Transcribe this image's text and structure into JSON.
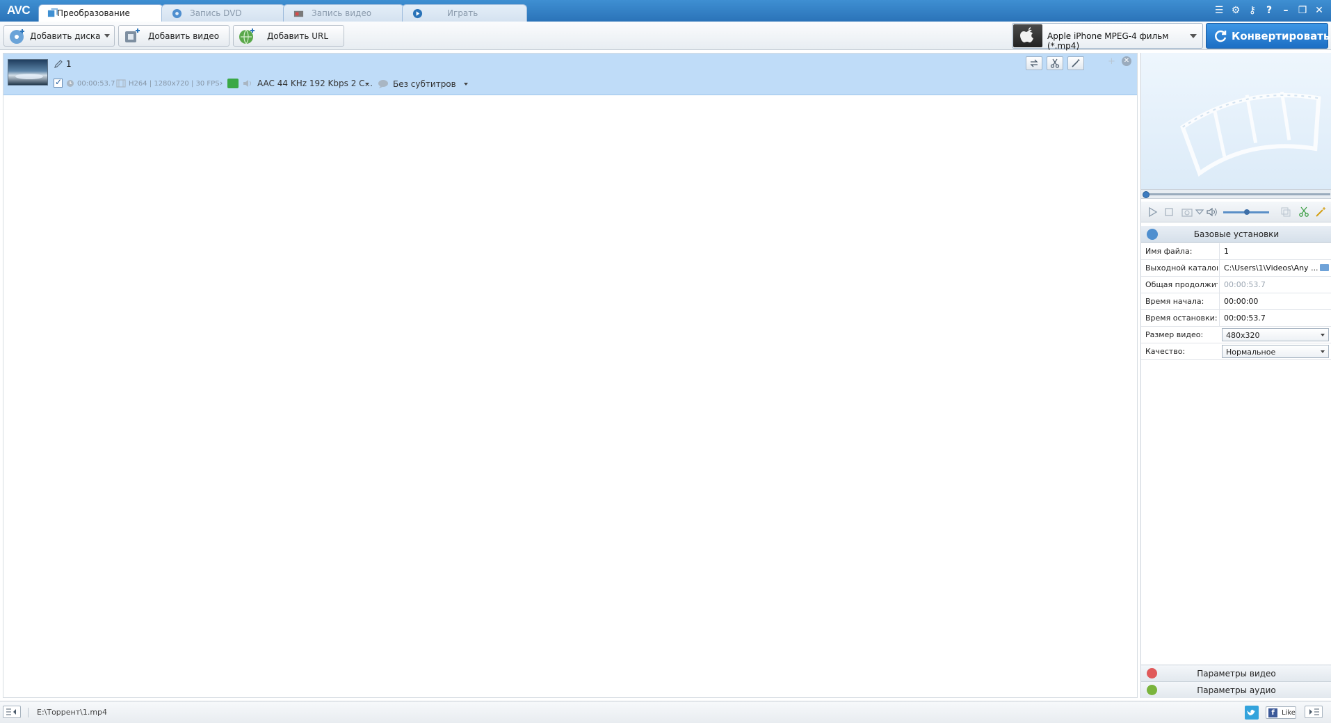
{
  "app": {
    "logo": "AVC"
  },
  "tabs": [
    {
      "label": "Преобразование",
      "icon": "convert-icon",
      "active": true
    },
    {
      "label": "Запись DVD",
      "icon": "disc-icon",
      "active": false
    },
    {
      "label": "Запись видео",
      "icon": "record-icon",
      "active": false
    },
    {
      "label": "Играть",
      "icon": "play-icon",
      "active": false
    }
  ],
  "window_controls": [
    "menu-icon",
    "gear-icon",
    "key-icon",
    "help-icon",
    "minimize-icon",
    "restore-icon",
    "close-icon"
  ],
  "toolbar": {
    "add_disc": "Добавить диска",
    "add_video": "Добавить видео",
    "add_url": "Добавить URL",
    "profile": "Apple iPhone MPEG-4 фильм (*.mp4)",
    "convert": "Конвертировать!"
  },
  "file": {
    "name": "1",
    "checked": true,
    "duration": "00:00:53.7",
    "codec": "H264 | 1280x720 | 30 FPS",
    "audio": "AAC 44 KHz 192 Kbps 2 C...",
    "subtitles": "Без субтитров"
  },
  "settings": {
    "section_title": "Базовые установки",
    "rows": [
      {
        "key": "Имя файла:",
        "value": "1"
      },
      {
        "key": "Выходной каталог:",
        "value": "C:\\Users\\1\\Videos\\Any ..."
      },
      {
        "key": "Общая продолжит",
        "value": "00:00:53.7"
      },
      {
        "key": "Время начала:",
        "value": "00:00:00"
      },
      {
        "key": "Время остановки:",
        "value": "00:00:53.7"
      },
      {
        "key": "Размер видео:",
        "value": "480x320"
      },
      {
        "key": "Качество:",
        "value": "Нормальное"
      }
    ],
    "video_params": "Параметры видео",
    "audio_params": "Параметры аудио"
  },
  "player": {
    "seek_position": 0,
    "volume": 0.5
  },
  "statusbar": {
    "path": "E:\\Торрент\\1.mp4",
    "like": "Like"
  },
  "colors": {
    "accent": "#2a73b8",
    "row_selected": "#bfdcf8",
    "convert_button": "#1c6ec4"
  }
}
